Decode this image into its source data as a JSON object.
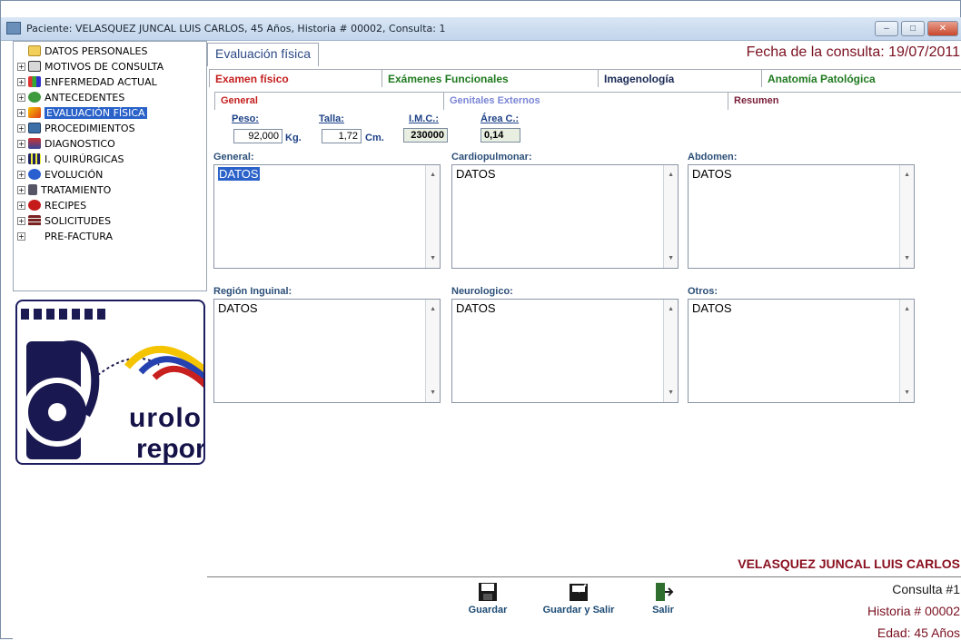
{
  "window": {
    "title": "Paciente: VELASQUEZ JUNCAL LUIS CARLOS, 45 Años, Historia # 00002, Consulta: 1",
    "min_label": "–",
    "max_label": "□",
    "close_label": "✕"
  },
  "tree": [
    {
      "label": "DATOS PERSONALES",
      "icon": "folder-icon",
      "expander": ""
    },
    {
      "label": "MOTIVOS DE CONSULTA",
      "icon": "triangle-icon",
      "expander": "+"
    },
    {
      "label": "ENFERMEDAD ACTUAL",
      "icon": "bar-chart-icon",
      "expander": "+"
    },
    {
      "label": "ANTECEDENTES",
      "icon": "money-bag-icon",
      "expander": "+"
    },
    {
      "label": "EVALUACIÓN FÍSICA",
      "icon": "lightning-icon",
      "expander": "+",
      "selected": true
    },
    {
      "label": "PROCEDIMIENTOS",
      "icon": "image-icon",
      "expander": "+"
    },
    {
      "label": "DIAGNOSTICO",
      "icon": "pointer-icon",
      "expander": "+"
    },
    {
      "label": "I. QUIRÚRGICAS",
      "icon": "grid-icon",
      "expander": "+"
    },
    {
      "label": "EVOLUCIÓN",
      "icon": "info-icon",
      "expander": "+"
    },
    {
      "label": "TRATAMIENTO",
      "icon": "figure-icon",
      "expander": "+"
    },
    {
      "label": "RECIPES",
      "icon": "apple-icon",
      "expander": "+"
    },
    {
      "label": "SOLICITUDES",
      "icon": "stack-icon",
      "expander": "+"
    },
    {
      "label": "PRE-FACTURA",
      "icon": "",
      "expander": "+"
    }
  ],
  "logo": {
    "text1": "urolo",
    "text2": "report"
  },
  "header": {
    "section_tab": "Evaluación física",
    "fecha_label": "Fecha de la consulta:",
    "fecha_value": "19/07/2011"
  },
  "tabs": [
    {
      "label": "Examen físico",
      "color": "#c41f1f",
      "active": true
    },
    {
      "label": "Exámenes Funcionales",
      "color": "#1f7a1f"
    },
    {
      "label": "Imagenología",
      "color": "#1a2a55"
    },
    {
      "label": "Anatomía Patológica",
      "color": "#1f7a1f"
    }
  ],
  "subtabs": [
    {
      "label": "General",
      "color": "#c41f1f",
      "active": true
    },
    {
      "label": "Genitales Externos",
      "color": "#7b86d6"
    },
    {
      "label": "Resumen",
      "color": "#7a1f3a"
    }
  ],
  "measures": {
    "peso_label": "Peso:",
    "peso_value": "92,000",
    "peso_unit": "Kg.",
    "talla_label": "Talla:",
    "talla_value": "1,72",
    "talla_unit": "Cm.",
    "imc_label": "I.M.C.:",
    "imc_value": "230000",
    "area_label": "Área C.:",
    "area_value": "0,14"
  },
  "fields": [
    {
      "label": "General:",
      "value": "DATOS"
    },
    {
      "label": "Cardiopulmonar:",
      "value": "DATOS"
    },
    {
      "label": "Abdomen:",
      "value": "DATOS"
    },
    {
      "label": "Región Inguinal:",
      "value": "DATOS"
    },
    {
      "label": "Neurologico:",
      "value": "DATOS"
    },
    {
      "label": "Otros:",
      "value": "DATOS"
    }
  ],
  "patient": {
    "name": "VELASQUEZ JUNCAL LUIS CARLOS",
    "consulta": "Consulta #1",
    "historia": "Historia # 00002",
    "edad": "Edad: 45 Años"
  },
  "buttons": {
    "guardar": "Guardar",
    "guardar_salir": "Guardar y Salir",
    "salir": "Salir"
  },
  "colors": {
    "accent_blue": "#2a62c9",
    "maroon": "#7a1020"
  }
}
